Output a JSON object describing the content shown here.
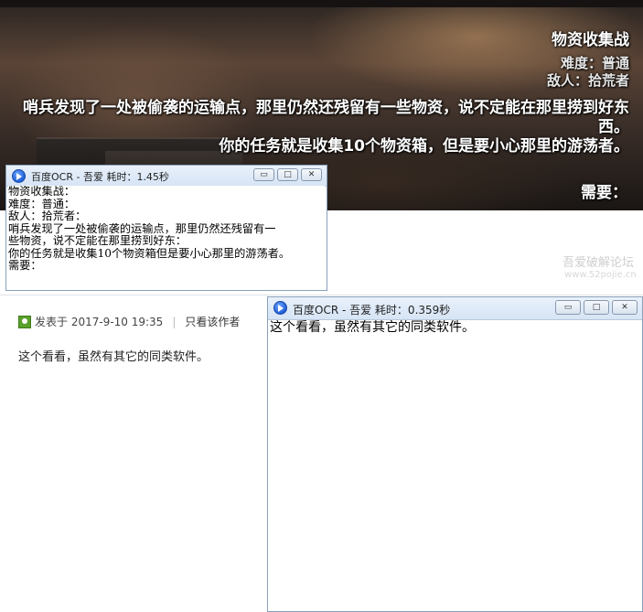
{
  "banner": {
    "title": "物资收集战",
    "difficulty": "难度：普通",
    "enemy": "敌人：拾荒者",
    "desc_line1": "哨兵发现了一处被偷袭的运输点，那里仍然还残留有一些物资，说不定能在那里捞到好东",
    "desc_line2": "西。",
    "desc_line3": "你的任务就是收集10个物资箱，但是要小心那里的游荡者。",
    "need": "需要："
  },
  "ocr_window_1": {
    "title": "百度OCR - 吾爱    耗时：1.45秒",
    "buttons": {
      "minimize": "▭",
      "maximize": "□",
      "close": "✕"
    },
    "lines": [
      "物资收集战：",
      "难度：普通：",
      "敌人：拾荒者：",
      "  哨兵发现了一处被偷袭的运输点，那里仍然还残留有一",
      "些物资，说不定能在那里捞到好东：",
      "你的任务就是收集10个物资箱但是要小心那里的游荡者。",
      "需要："
    ]
  },
  "forum": {
    "watermark": "吾爱破解论坛",
    "watermark_url": "www.52pojie.cn",
    "post_meta": "发表于 2017-9-10 19:35",
    "divider": "|",
    "author_only": "只看该作者",
    "content": "这个看看，虽然有其它的同类软件。"
  },
  "ocr_window_2": {
    "title": "百度OCR - 吾爱    耗时：0.359秒",
    "buttons": {
      "minimize": "▭",
      "maximize": "□",
      "close": "✕"
    },
    "lines": [
      "这个看看，虽然有其它的同类软件。"
    ]
  }
}
